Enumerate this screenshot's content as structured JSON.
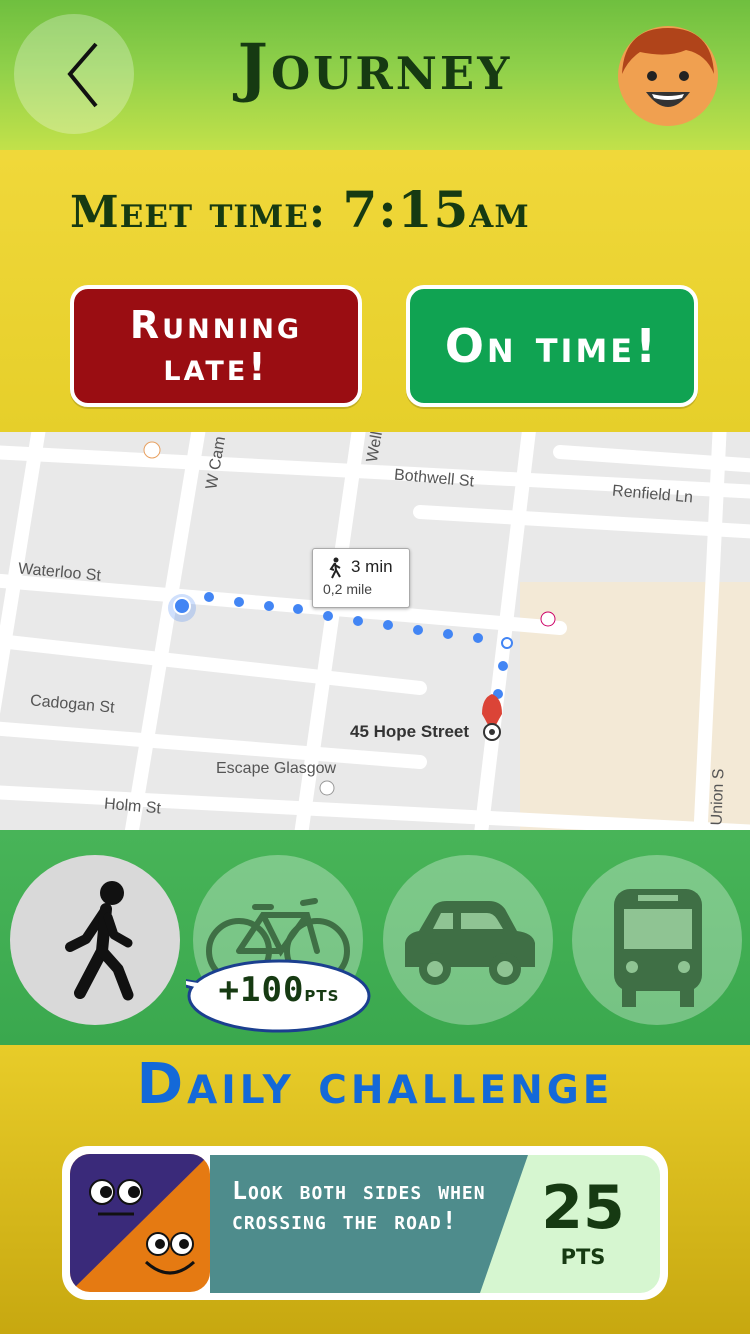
{
  "header": {
    "title": "Journey"
  },
  "meet": {
    "label": "Meet time:",
    "time": "7:15",
    "ampm": "am",
    "late_label": "Running late!",
    "ontime_label": "On time!"
  },
  "map": {
    "streets": [
      "Bothwell St",
      "Renfield Ln",
      "Waterloo St",
      "Cadogan St",
      "Holm St",
      "W Cam",
      "Well",
      "Union S"
    ],
    "place": "Escape Glasgow",
    "destination": "45 Hope Street",
    "eta_time": "3 min",
    "eta_distance": "0,2 mile",
    "colors": {
      "route": "#4285f4",
      "pin": "#db4437"
    }
  },
  "transport": {
    "modes": [
      "walk-icon",
      "bicycle-icon",
      "car-icon",
      "bus-icon"
    ],
    "selected": "walk",
    "points_value": "+100",
    "points_unit": "pts"
  },
  "challenge": {
    "title": "Daily challenge",
    "tip": "Look both sides when crossing the road!",
    "points": "25",
    "points_unit": "pts"
  },
  "colors": {
    "late": "#9a0d12",
    "ontime": "#10a352",
    "title_dark": "#163a12",
    "challenge_blue": "#1469d8"
  }
}
